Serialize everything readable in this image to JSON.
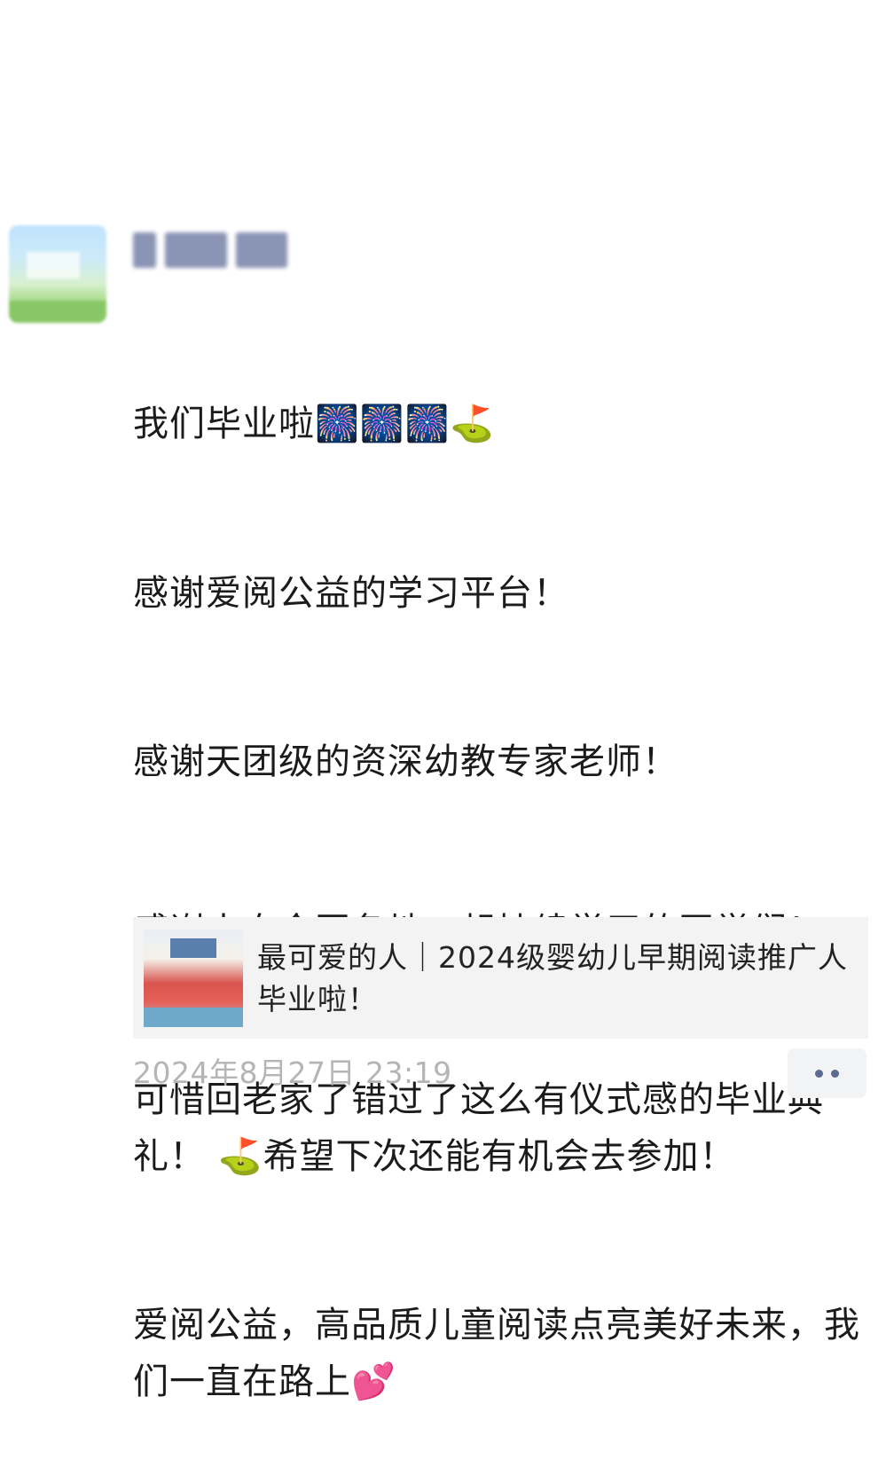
{
  "post": {
    "author_name": "",
    "lines": [
      "我们毕业啦🎆🎆🎆⛳",
      "感谢爱阅公益的学习平台！",
      "感谢天团级的资深幼教专家老师！",
      "感谢来自全国各地一起持续学习的同学们！",
      "可惜回老家了错过了这么有仪式感的毕业典礼！ ⛳希望下次还能有机会去参加！",
      "爱阅公益，高品质儿童阅读点亮美好未来，我们一直在路上💕"
    ],
    "link_card": {
      "title": "最可爱的人｜2024级婴幼儿早期阅读推广人毕业啦！",
      "thumbnail_icon": "group-photo-thumbnail"
    },
    "timestamp": "2024年8月27日 23:19",
    "more_icon": "more-dots-icon"
  },
  "colors": {
    "text": "#1b1b1b",
    "timestamp": "#b5b5b5",
    "card_bg": "#f3f3f3",
    "more_dots": "#5b6a91"
  }
}
